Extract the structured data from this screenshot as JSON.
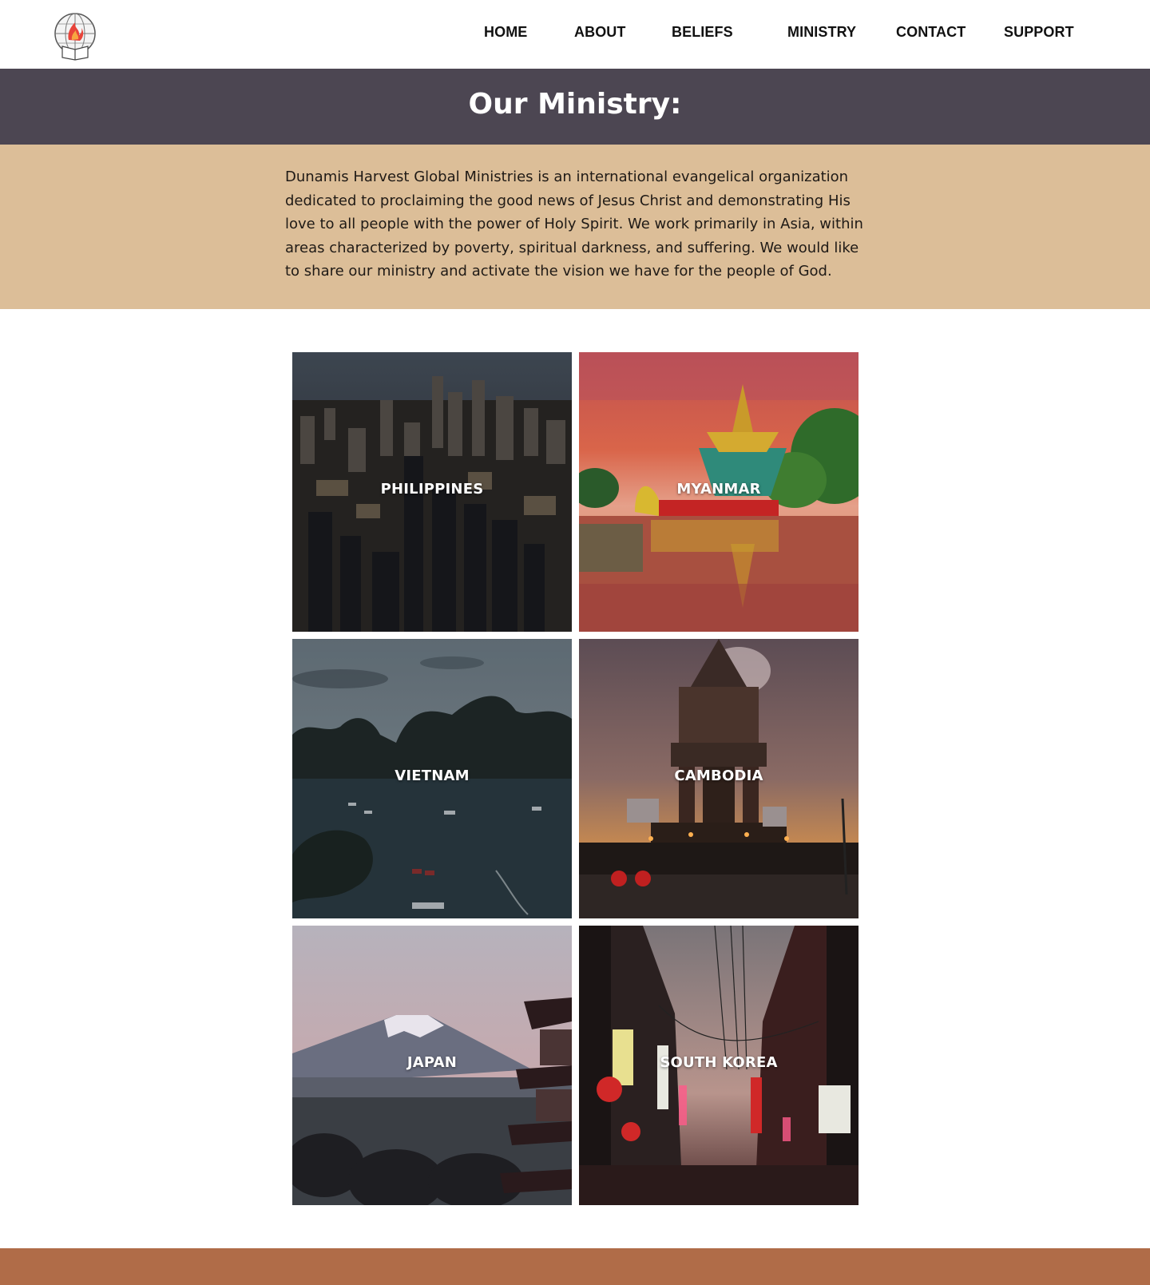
{
  "nav": {
    "items": [
      {
        "label": "HOME"
      },
      {
        "label": "ABOUT"
      },
      {
        "label": "BELIEFS"
      },
      {
        "label": "MINISTRY"
      },
      {
        "label": "CONTACT"
      },
      {
        "label": "SUPPORT"
      }
    ]
  },
  "hero": {
    "title": "Our Ministry:"
  },
  "intro": {
    "text": "Dunamis Harvest Global Ministries is an international evangelical organization dedicated to proclaiming the good news of Jesus Christ and demonstrating His love to all people with the power of Holy Spirit. We work primarily in Asia, within areas characterized by poverty, spiritual darkness, and suffering. We would like to share our ministry and activate the vision we have for the people of God."
  },
  "countries": [
    {
      "label": "PHILIPPINES"
    },
    {
      "label": "MYANMAR"
    },
    {
      "label": "VIETNAM"
    },
    {
      "label": "CAMBODIA"
    },
    {
      "label": "JAPAN"
    },
    {
      "label": "SOUTH KOREA"
    }
  ],
  "colors": {
    "title_band": "#4c4652",
    "intro_band": "#dcbe98",
    "footer_band": "#b06c48"
  }
}
